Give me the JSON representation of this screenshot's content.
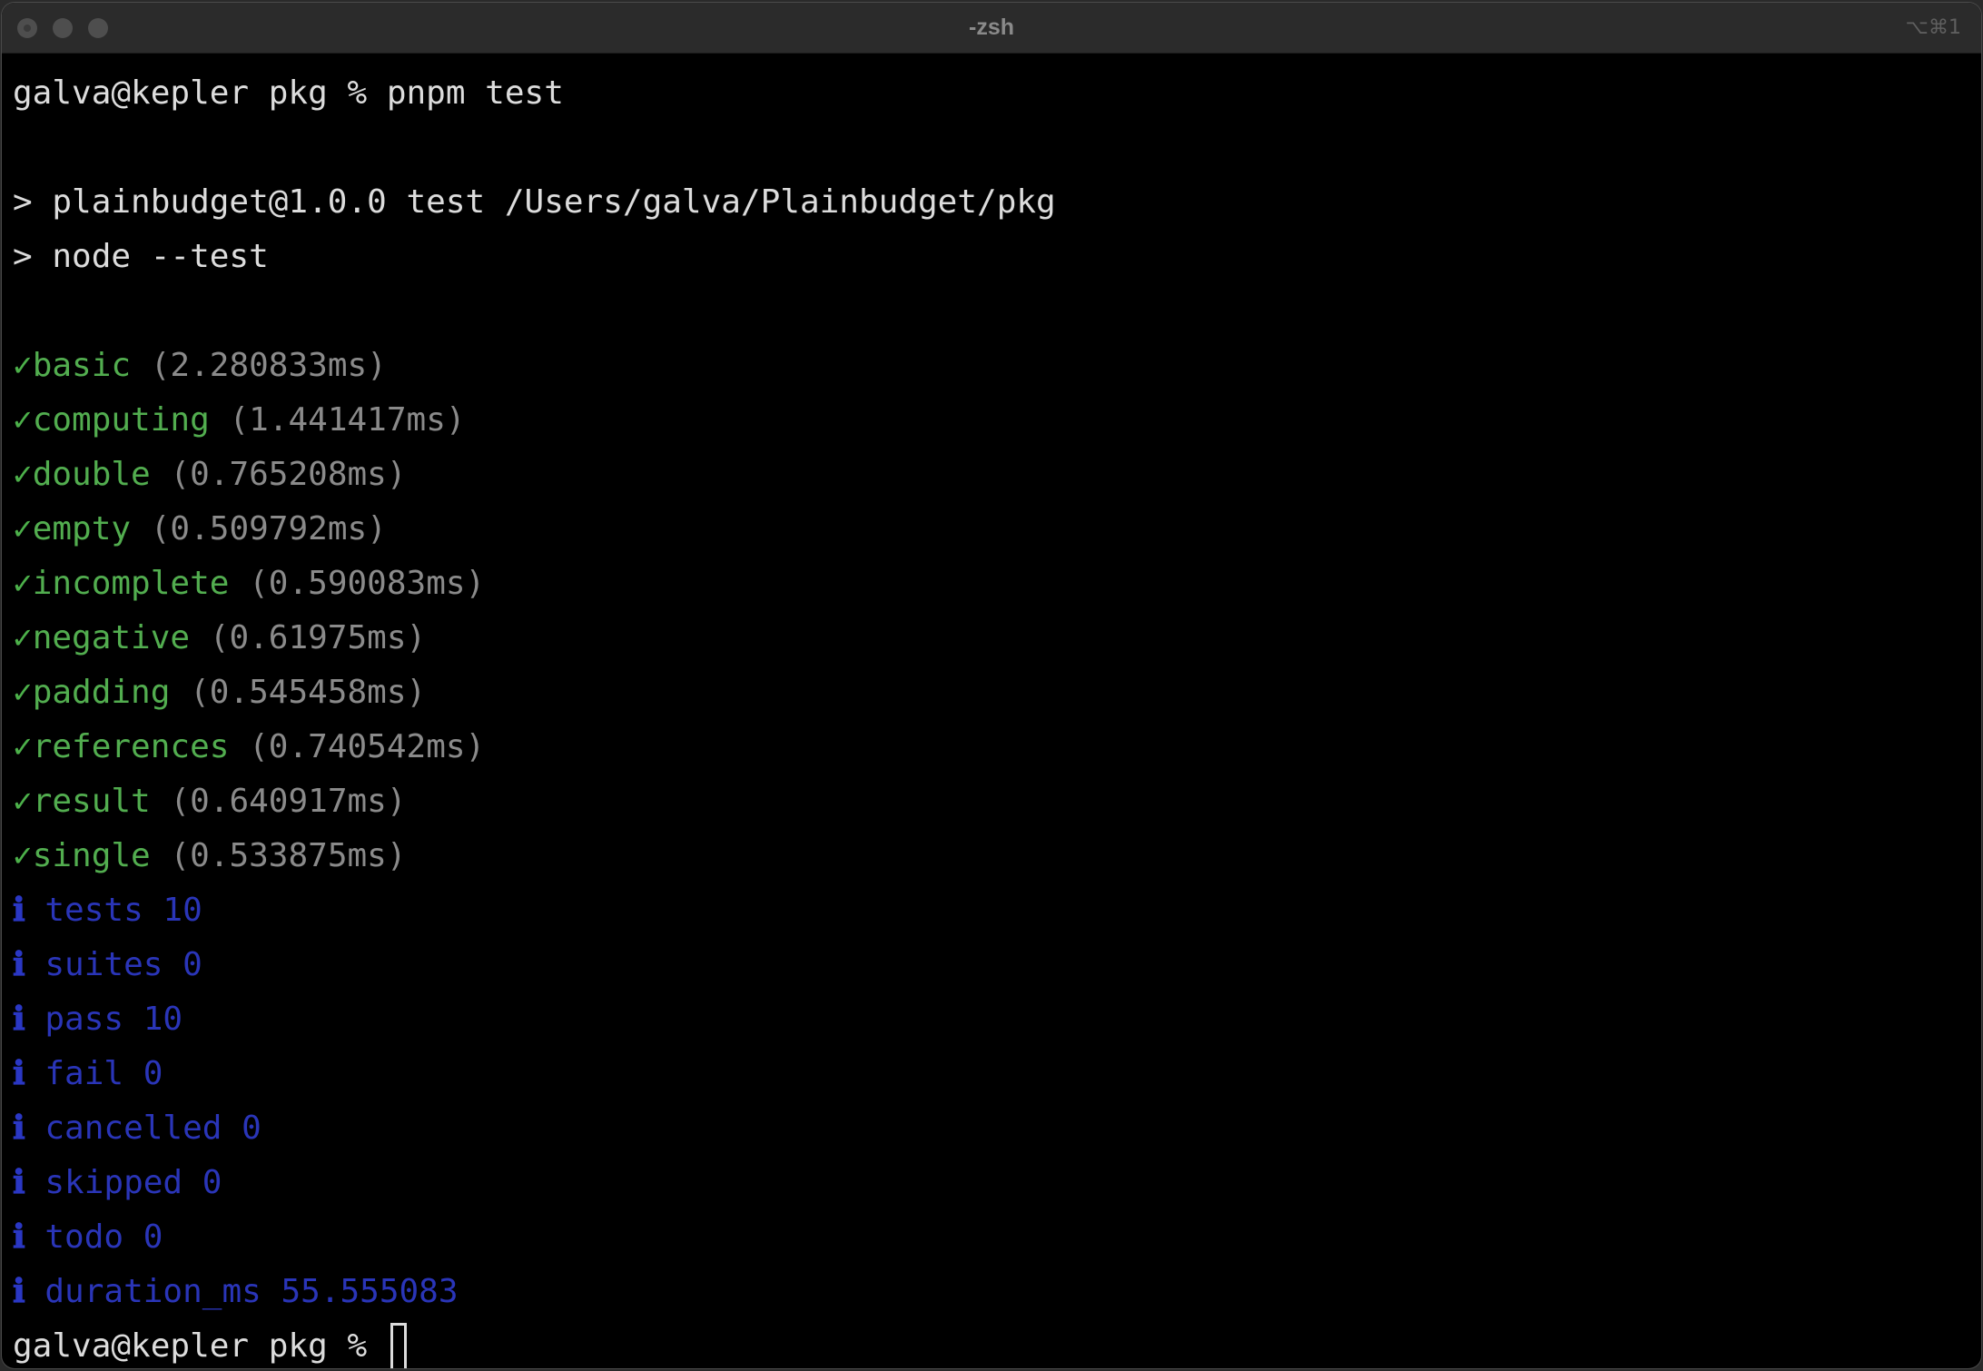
{
  "window": {
    "title": "-zsh",
    "shortcut": "⌥⌘1"
  },
  "terminal": {
    "prompt": "galva@kepler pkg % ",
    "command": "pnpm test",
    "script_lines": [
      "> plainbudget@1.0.0 test /Users/galva/Plainbudget/pkg",
      "> node --test"
    ],
    "pass_glyph": "✓",
    "tests": [
      {
        "name": "basic",
        "duration": "(2.280833ms)"
      },
      {
        "name": "computing",
        "duration": "(1.441417ms)"
      },
      {
        "name": "double",
        "duration": "(0.765208ms)"
      },
      {
        "name": "empty",
        "duration": "(0.509792ms)"
      },
      {
        "name": "incomplete",
        "duration": "(0.590083ms)"
      },
      {
        "name": "negative",
        "duration": "(0.61975ms)"
      },
      {
        "name": "padding",
        "duration": "(0.545458ms)"
      },
      {
        "name": "references",
        "duration": "(0.740542ms)"
      },
      {
        "name": "result",
        "duration": "(0.640917ms)"
      },
      {
        "name": "single",
        "duration": "(0.533875ms)"
      }
    ],
    "info_glyph": "ℹ",
    "summary": [
      "tests 10",
      "suites 0",
      "pass 10",
      "fail 0",
      "cancelled 0",
      "skipped 0",
      "todo 0",
      "duration_ms 55.555083"
    ],
    "final_prompt": "galva@kepler pkg % "
  },
  "colors": {
    "background": "#000000",
    "pass_green": "#52ad4f",
    "info_blue": "#2a35b8",
    "duration_gray": "#8a8a8a",
    "text": "#dcdcdc"
  }
}
